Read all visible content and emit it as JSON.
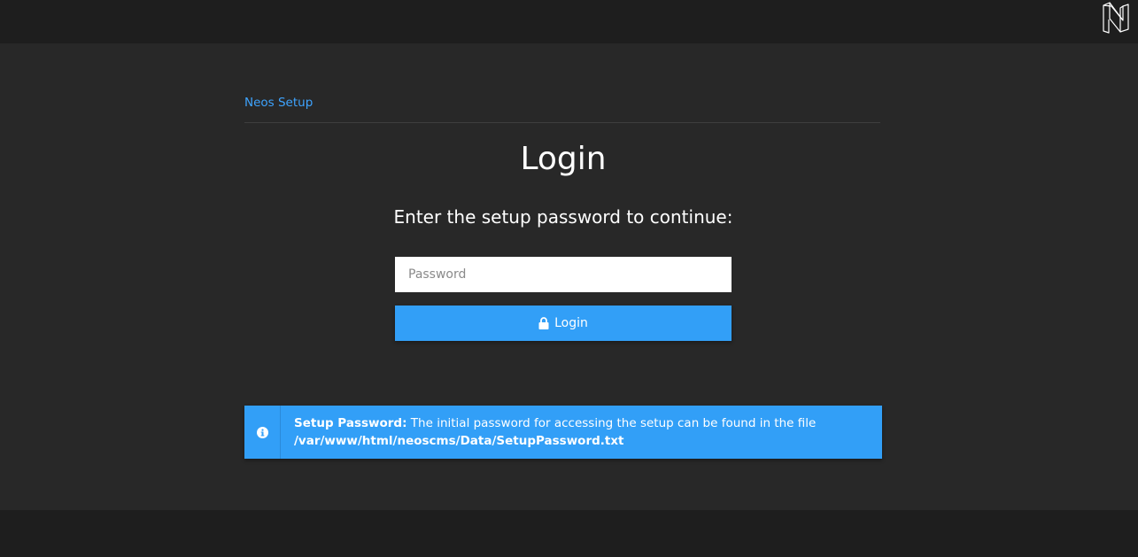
{
  "header": {
    "logo_icon": "neos-logo-icon"
  },
  "breadcrumb": {
    "label": "Neos Setup"
  },
  "login": {
    "title": "Login",
    "subtitle": "Enter the setup password to continue:",
    "password_placeholder": "Password",
    "password_value": "",
    "button_label": "Login",
    "button_icon": "lock-icon"
  },
  "info": {
    "icon": "info-icon",
    "heading": "Setup Password:",
    "message": "The initial password for accessing the setup can be found in the file",
    "file_path": "/var/www/html/neoscms/Data/SetupPassword.txt"
  },
  "colors": {
    "accent": "#329ff7",
    "link": "#3ea4ff",
    "background": "#282828",
    "bar": "#1e1e1e"
  }
}
